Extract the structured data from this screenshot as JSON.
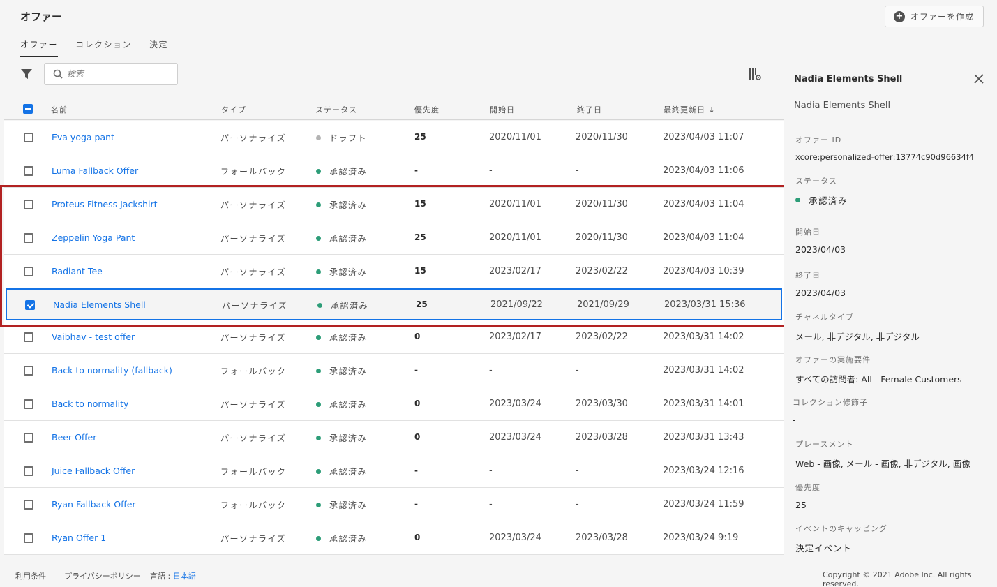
{
  "header": {
    "title": "オファー",
    "create_button": "オファーを作成",
    "tabs": [
      "オファー",
      "コレクション",
      "決定"
    ]
  },
  "toolbar": {
    "search_placeholder": "検索"
  },
  "table": {
    "columns": {
      "name": "名前",
      "type": "タイプ",
      "status": "ステータス",
      "priority": "優先度",
      "start": "開始日",
      "end": "終了日",
      "updated": "最終更新日 ↓"
    },
    "rows": [
      {
        "name": "Eva yoga pant",
        "type": "パーソナライズ",
        "status": "ドラフト",
        "status_color": "#b3b3b3",
        "priority": "25",
        "start": "2020/11/01",
        "end": "2020/11/30",
        "updated": "2023/04/03 11:07",
        "checked": false
      },
      {
        "name": "Luma Fallback Offer",
        "type": "フォールバック",
        "status": "承認済み",
        "status_color": "#2d9d78",
        "priority": "-",
        "start": "-",
        "end": "-",
        "updated": "2023/04/03 11:06",
        "checked": false
      },
      {
        "name": "Proteus Fitness Jackshirt",
        "type": "パーソナライズ",
        "status": "承認済み",
        "status_color": "#2d9d78",
        "priority": "15",
        "start": "2020/11/01",
        "end": "2020/11/30",
        "updated": "2023/04/03 11:04",
        "checked": false
      },
      {
        "name": "Zeppelin Yoga Pant",
        "type": "パーソナライズ",
        "status": "承認済み",
        "status_color": "#2d9d78",
        "priority": "25",
        "start": "2020/11/01",
        "end": "2020/11/30",
        "updated": "2023/04/03 11:04",
        "checked": false
      },
      {
        "name": "Radiant Tee",
        "type": "パーソナライズ",
        "status": "承認済み",
        "status_color": "#2d9d78",
        "priority": "15",
        "start": "2023/02/17",
        "end": "2023/02/22",
        "updated": "2023/04/03 10:39",
        "checked": false
      },
      {
        "name": "Nadia Elements Shell",
        "type": "パーソナライズ",
        "status": "承認済み",
        "status_color": "#2d9d78",
        "priority": "25",
        "start": "2021/09/22",
        "end": "2021/09/29",
        "updated": "2023/03/31 15:36",
        "checked": true
      },
      {
        "name": "Vaibhav - test offer",
        "type": "パーソナライズ",
        "status": "承認済み",
        "status_color": "#2d9d78",
        "priority": "0",
        "start": "2023/02/17",
        "end": "2023/02/22",
        "updated": "2023/03/31 14:02",
        "checked": false
      },
      {
        "name": "Back to normality (fallback)",
        "type": "フォールバック",
        "status": "承認済み",
        "status_color": "#2d9d78",
        "priority": "-",
        "start": "-",
        "end": "-",
        "updated": "2023/03/31 14:02",
        "checked": false
      },
      {
        "name": "Back to normality",
        "type": "パーソナライズ",
        "status": "承認済み",
        "status_color": "#2d9d78",
        "priority": "0",
        "start": "2023/03/24",
        "end": "2023/03/30",
        "updated": "2023/03/31 14:01",
        "checked": false
      },
      {
        "name": "Beer Offer",
        "type": "パーソナライズ",
        "status": "承認済み",
        "status_color": "#2d9d78",
        "priority": "0",
        "start": "2023/03/24",
        "end": "2023/03/28",
        "updated": "2023/03/31 13:43",
        "checked": false
      },
      {
        "name": "Juice Fallback Offer",
        "type": "フォールバック",
        "status": "承認済み",
        "status_color": "#2d9d78",
        "priority": "-",
        "start": "-",
        "end": "-",
        "updated": "2023/03/24 12:16",
        "checked": false
      },
      {
        "name": "Ryan Fallback Offer",
        "type": "フォールバック",
        "status": "承認済み",
        "status_color": "#2d9d78",
        "priority": "-",
        "start": "-",
        "end": "-",
        "updated": "2023/03/24 11:59",
        "checked": false
      },
      {
        "name": "Ryan Offer 1",
        "type": "パーソナライズ",
        "status": "承認済み",
        "status_color": "#2d9d78",
        "priority": "0",
        "start": "2023/03/24",
        "end": "2023/03/28",
        "updated": "2023/03/24 9:19",
        "checked": false
      }
    ]
  },
  "panel": {
    "title": "Nadia Elements Shell",
    "subtitle": "Nadia Elements Shell",
    "offer_id_label": "オファー ID",
    "offer_id": "xcore:personalized-offer:13774c90d96634f4",
    "status_label": "ステータス",
    "status": "承認済み",
    "start_label": "開始日",
    "start": "2023/04/03",
    "end_label": "終了日",
    "end": "2023/04/03",
    "channel_label": "チャネルタイプ",
    "channel": "メール, 非デジタル, 非デジタル",
    "eligibility_label": "オファーの実施要件",
    "eligibility": "すべての訪問者: All - Female Customers",
    "collection_label": "コレクション修飾子",
    "collection": "-",
    "placement_label": "プレースメント",
    "placement": "Web - 画像, メール - 画像, 非デジタル, 画像",
    "priority_label": "優先度",
    "priority": "25",
    "capping_label": "イベントのキャッピング",
    "capping": "決定イベント"
  },
  "footer": {
    "terms": "利用条件",
    "privacy": "プライバシーポリシー",
    "language_label": "言語 : ",
    "language": "日本語",
    "copyright": "Copyright © 2021 Adobe Inc. All rights reserved."
  }
}
